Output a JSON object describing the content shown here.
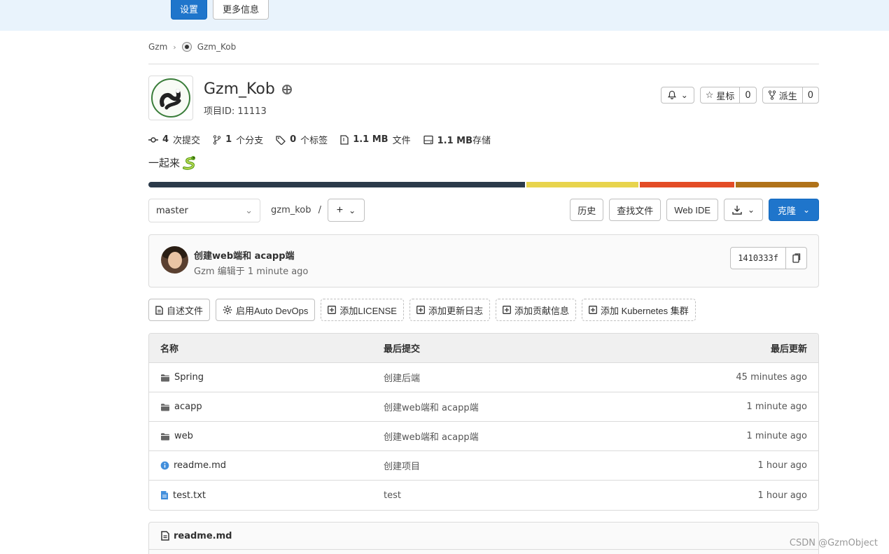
{
  "topbar": {
    "settings_label": "设置",
    "more_info_label": "更多信息"
  },
  "breadcrumb": {
    "group": "Gzm",
    "project": "Gzm_Kob"
  },
  "project": {
    "name": "Gzm_Kob",
    "id_label": "项目ID: 11113"
  },
  "header_actions": {
    "star_label": "星标",
    "star_count": "0",
    "fork_label": "派生",
    "fork_count": "0"
  },
  "stats": {
    "commits_num": "4",
    "commits_label": "次提交",
    "branches_num": "1",
    "branches_label": "个分支",
    "tags_num": "0",
    "tags_label": "个标签",
    "files_num": "1.1 MB",
    "files_label": "文件",
    "storage_num": "1.1 MB",
    "storage_label": "存储"
  },
  "description": "一起来",
  "languages": [
    {
      "fraction": 0.565,
      "color": "#2b3a4a"
    },
    {
      "fraction": 0.168,
      "color": "#e8d44d"
    },
    {
      "fraction": 0.142,
      "color": "#e34c26"
    },
    {
      "fraction": 0.125,
      "color": "#b07219"
    }
  ],
  "toolbar": {
    "branch": "master",
    "path": "gzm_kob",
    "path_sep": "/",
    "history_label": "历史",
    "find_file_label": "查找文件",
    "web_ide_label": "Web IDE",
    "clone_label": "克隆"
  },
  "last_commit": {
    "title": "创建web端和 acapp端",
    "meta": "Gzm 编辑于 1 minute ago",
    "sha": "1410333f"
  },
  "quick_actions": [
    {
      "label": "自述文件",
      "dashed": false,
      "icon": "file-icon"
    },
    {
      "label": "启用Auto DevOps",
      "dashed": false,
      "icon": "gear-icon"
    },
    {
      "label": "添加LICENSE",
      "dashed": true,
      "icon": "plus-square-icon"
    },
    {
      "label": "添加更新日志",
      "dashed": true,
      "icon": "plus-square-icon"
    },
    {
      "label": "添加贡献信息",
      "dashed": true,
      "icon": "plus-square-icon"
    },
    {
      "label": "添加 Kubernetes 集群",
      "dashed": true,
      "icon": "plus-square-icon"
    }
  ],
  "files_table": {
    "headers": {
      "name": "名称",
      "last_commit": "最后提交",
      "last_update": "最后更新"
    },
    "rows": [
      {
        "type": "folder",
        "name": "Spring",
        "commit": "创建后端",
        "updated": "45 minutes ago"
      },
      {
        "type": "folder",
        "name": "acapp",
        "commit": "创建web端和 acapp端",
        "updated": "1 minute ago"
      },
      {
        "type": "folder",
        "name": "web",
        "commit": "创建web端和 acapp端",
        "updated": "1 minute ago"
      },
      {
        "type": "info",
        "name": "readme.md",
        "commit": "创建项目",
        "updated": "1 hour ago"
      },
      {
        "type": "file",
        "name": "test.txt",
        "commit": "test",
        "updated": "1 hour ago"
      }
    ]
  },
  "readme": {
    "title": "readme.md"
  },
  "watermark": "CSDN @GzmObject"
}
